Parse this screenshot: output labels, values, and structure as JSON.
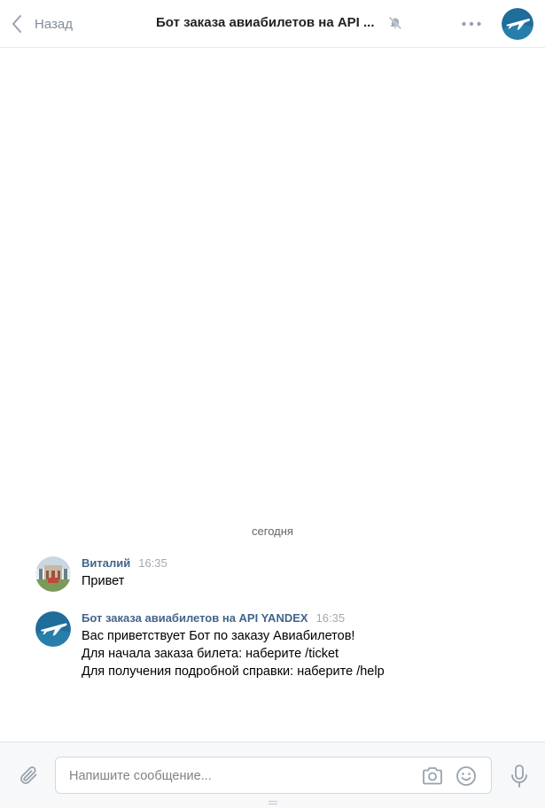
{
  "header": {
    "back_label": "Назад",
    "title": "Бот заказа авиабилетов на API ...",
    "icons": {
      "back": "chevron-left-icon",
      "mute": "muted-bell-icon",
      "more": "more-horizontal-icon",
      "avatar": "plane-avatar"
    }
  },
  "chat": {
    "date_separator": "сегодня",
    "messages": [
      {
        "author": "Виталий",
        "time": "16:35",
        "lines": [
          "Привет"
        ],
        "avatar": "user-photo-avatar"
      },
      {
        "author": "Бот заказа авиабилетов на API YANDEX",
        "time": "16:35",
        "lines": [
          "Вас приветствует Бот по заказу Авиабилетов!",
          "Для начала заказа билета: наберите /ticket",
          "Для получения подробной справки: наберите /help"
        ],
        "avatar": "plane-avatar"
      }
    ]
  },
  "composer": {
    "placeholder": "Напишите сообщение...",
    "value": "",
    "icons": {
      "attach": "paperclip-icon",
      "camera": "camera-icon",
      "emoji": "smile-icon",
      "voice": "microphone-icon"
    }
  },
  "colors": {
    "accent_author": "#42648b",
    "muted_text": "#818c99",
    "border": "#e7e8ec",
    "composer_bg": "#f7f8fa",
    "avatar_blue": "#1f6d9a"
  }
}
